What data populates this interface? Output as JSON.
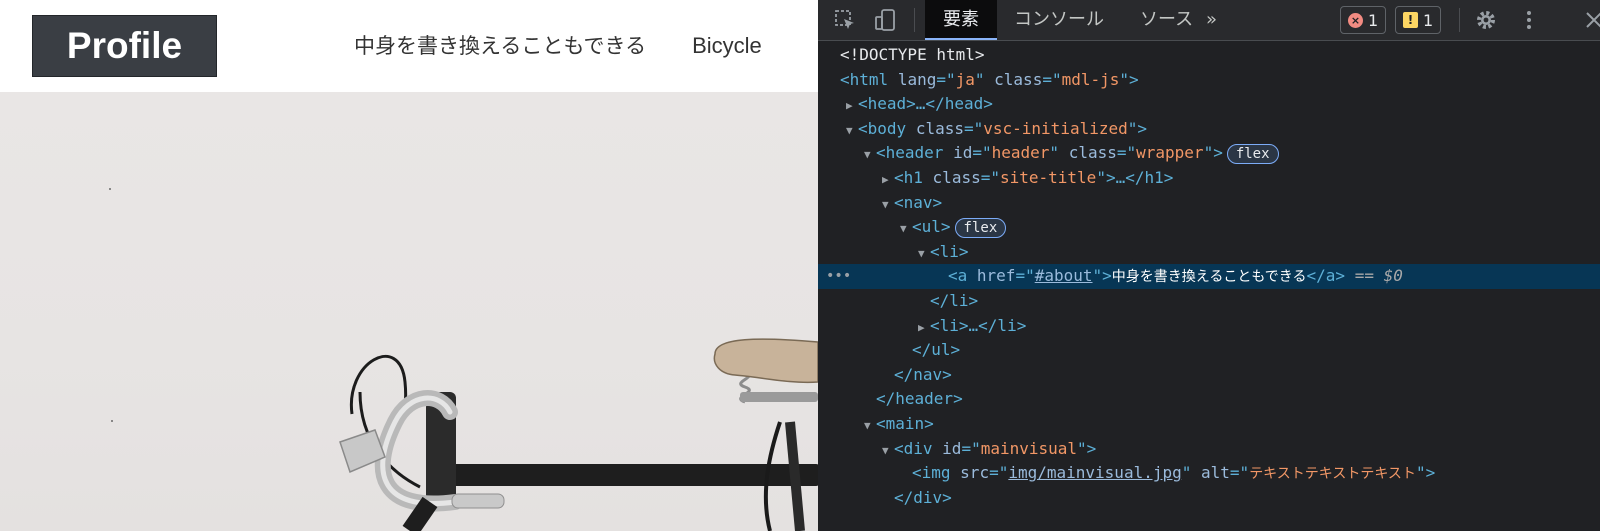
{
  "site": {
    "title": "Profile",
    "nav": [
      "中身を書き換えることもできる",
      "Bicycle"
    ]
  },
  "devtools": {
    "tabs": [
      "要素",
      "コンソール",
      "ソース"
    ],
    "more_tabs": "»",
    "errors": "1",
    "warnings": "1",
    "selected_suffix": "== $0",
    "dom": {
      "doctype": "<!DOCTYPE html>",
      "html_open": "<html",
      "html_lang_attr": "lang",
      "html_lang": "ja",
      "html_class_attr": "class",
      "html_class": "mdl-js",
      "head": "<head>…</head>",
      "body_tag": "<body",
      "body_class": "vsc-initialized",
      "header_tag": "<header",
      "header_id": "header",
      "header_class": "wrapper",
      "flex": "flex",
      "h1_tag": "<h1",
      "h1_class": "site-title",
      "h1_rest": ">…</h1>",
      "nav_open": "<nav>",
      "ul_open": "<ul>",
      "li_open": "<li>",
      "a_tag": "<a",
      "a_href_attr": "href",
      "a_href": "#about",
      "a_text": "中身を書き換えることもできる",
      "a_close": "</a>",
      "li_close": "</li>",
      "li_collapsed": "<li>…</li>",
      "ul_close": "</ul>",
      "nav_close": "</nav>",
      "header_close": "</header>",
      "main_open": "<main>",
      "div_tag": "<div",
      "div_id": "mainvisual",
      "img_tag": "<img",
      "img_src": "img/mainvisual.jpg",
      "img_alt": "テキストテキストテキスト",
      "div_close": "</div>"
    }
  }
}
